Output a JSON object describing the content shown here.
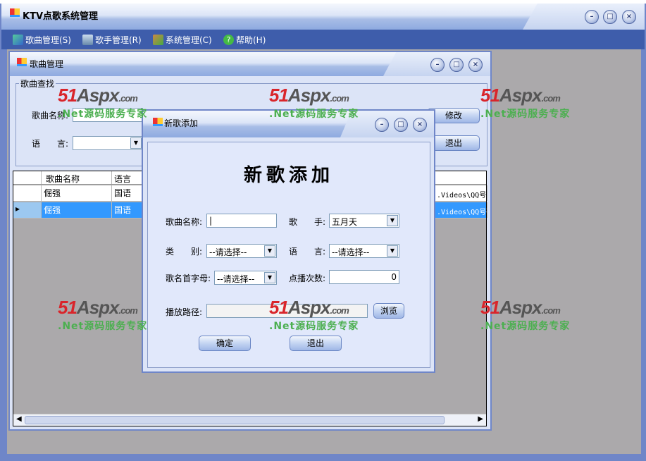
{
  "main_window": {
    "title": "KTV点歌系统管理",
    "controls": [
      "minimize",
      "maximize",
      "close"
    ]
  },
  "menu": [
    {
      "label": "歌曲管理(S)",
      "icon": "music-icon"
    },
    {
      "label": "歌手管理(R)",
      "icon": "monitor-icon"
    },
    {
      "label": "系统管理(C)",
      "icon": "users-icon"
    },
    {
      "label": "帮助(H)",
      "icon": "help-icon"
    }
  ],
  "song_manager": {
    "title": "歌曲管理",
    "search_group": "歌曲查找",
    "name_label": "歌曲名称:",
    "language_label": "语　　言:",
    "edit_button": "修改",
    "exit_button": "退出",
    "grid": {
      "columns": [
        "歌曲名称",
        "语言"
      ],
      "rows": [
        {
          "name": "倔强",
          "language": "国语",
          "path": ".Videos\\QQ号码"
        },
        {
          "name": "倔强",
          "language": "国语",
          "path": ".Videos\\QQ号码",
          "selected": true
        }
      ]
    }
  },
  "add_dialog": {
    "title": "新歌添加",
    "heading": "新歌添加",
    "song_name_label": "歌曲名称:",
    "song_name_value": "|",
    "singer_label": "歌　　手:",
    "singer_value": "五月天",
    "category_label": "类　　别:",
    "category_value": "--请选择--",
    "language_label": "语　　言:",
    "language_value": "--请选择--",
    "initial_label": "歌名首字母:",
    "initial_value": "--请选择--",
    "play_count_label": "点播次数:",
    "play_count_value": "0",
    "path_label": "播放路径:",
    "path_value": "",
    "browse_button": "浏览",
    "ok_button": "确定",
    "exit_button": "退出"
  },
  "watermark": {
    "logo": "51Aspx.com",
    "slogan": ".Net源码服务专家"
  }
}
